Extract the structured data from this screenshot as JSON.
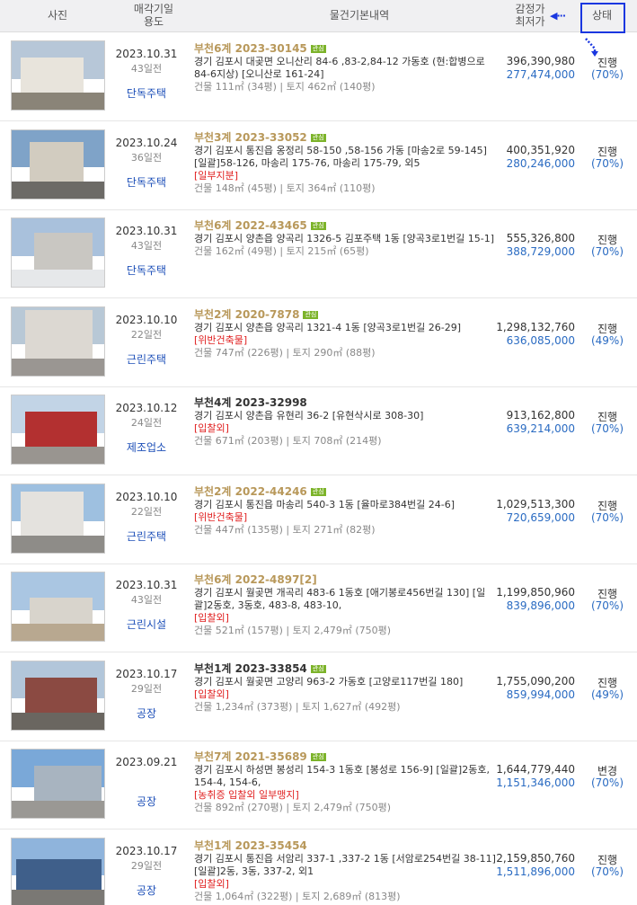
{
  "header": {
    "photo": "사진",
    "date_line1": "매각기일",
    "date_line2": "용도",
    "info": "물건기본내역",
    "price_line1": "감정가",
    "price_line2": "최저가",
    "status": "상태"
  },
  "rows": [
    {
      "date": "2023.10.31",
      "ago": "43일전",
      "use": "단독주택",
      "case": "부천6계 2023-30145",
      "badge": "관심",
      "case_color": "gold",
      "addr": "경기 김포시 대곶면 오니산리 84-6 ,83-2,84-12 가동호 (현:합병으로84-6지상) [오니산로 161-24]",
      "flags": "",
      "area": "건물 111㎡ (34평)  |  토지 462㎡ (140평)",
      "appraisal": "396,390,980",
      "minimum": "277,474,000",
      "status": "진행",
      "pct": "(70%)"
    },
    {
      "date": "2023.10.24",
      "ago": "36일전",
      "use": "단독주택",
      "case": "부천3계 2023-33052",
      "badge": "관심",
      "case_color": "gold",
      "addr": "경기 김포시 통진읍 옹정리 58-150 ,58-156 가동 [마송2로 59-145] [일괄]58-126, 마송리 175-76, 마송리 175-79, 외5",
      "flags": "[일부지분]",
      "area": "건물 148㎡ (45평)  |  토지 364㎡ (110평)",
      "appraisal": "400,351,920",
      "minimum": "280,246,000",
      "status": "진행",
      "pct": "(70%)"
    },
    {
      "date": "2023.10.31",
      "ago": "43일전",
      "use": "단독주택",
      "case": "부천6계 2022-43465",
      "badge": "관심",
      "case_color": "gold",
      "addr": "경기 김포시 양촌읍 양곡리 1326-5 김포주택 1동 [양곡3로1번길 15-1]",
      "flags": "",
      "area": "건물 162㎡ (49평)  |  토지 215㎡ (65평)",
      "appraisal": "555,326,800",
      "minimum": "388,729,000",
      "status": "진행",
      "pct": "(70%)"
    },
    {
      "date": "2023.10.10",
      "ago": "22일전",
      "use": "근린주택",
      "case": "부천2계 2020-7878",
      "badge": "관심",
      "case_color": "gold",
      "addr": "경기 김포시 양촌읍 양곡리 1321-4 1동 [양곡3로1번길 26-29]",
      "flags": "[위반건축물]",
      "area": "건물 747㎡ (226평)  |  토지 290㎡ (88평)",
      "appraisal": "1,298,132,760",
      "minimum": "636,085,000",
      "status": "진행",
      "pct": "(49%)"
    },
    {
      "date": "2023.10.12",
      "ago": "24일전",
      "use": "제조업소",
      "case": "부천4계 2023-32998",
      "badge": "",
      "case_color": "black",
      "addr": "경기 김포시 양촌읍 유현리 36-2 [유현삭시로 308-30]",
      "flags": "[입찰외]",
      "area": "건물 671㎡ (203평)  |  토지 708㎡ (214평)",
      "appraisal": "913,162,800",
      "minimum": "639,214,000",
      "status": "진행",
      "pct": "(70%)"
    },
    {
      "date": "2023.10.10",
      "ago": "22일전",
      "use": "근린주택",
      "case": "부천2계 2022-44246",
      "badge": "관심",
      "case_color": "gold",
      "addr": "경기 김포시 통진읍 마송리 540-3 1동 [율마로384번길 24-6]",
      "flags": "[위반건축물]",
      "area": "건물 447㎡ (135평)  |  토지 271㎡ (82평)",
      "appraisal": "1,029,513,300",
      "minimum": "720,659,000",
      "status": "진행",
      "pct": "(70%)"
    },
    {
      "date": "2023.10.31",
      "ago": "43일전",
      "use": "근린시설",
      "case": "부천6계 2022-4897[2]",
      "badge": "",
      "case_color": "gold",
      "addr": "경기 김포시 월곶면 개곡리 483-6 1동호 [애기봉로456번길 130] [일괄]2동호, 3동호, 483-8, 483-10,",
      "flags": "[입찰외]",
      "area": "건물 521㎡ (157평)  |  토지 2,479㎡ (750평)",
      "appraisal": "1,199,850,960",
      "minimum": "839,896,000",
      "status": "진행",
      "pct": "(70%)"
    },
    {
      "date": "2023.10.17",
      "ago": "29일전",
      "use": "공장",
      "case": "부천1계 2023-33854",
      "badge": "관심",
      "case_color": "black",
      "addr": "경기 김포시 월곶면 고양리 963-2 가동호 [고양로117번길 180]",
      "flags": "[입찰외]",
      "area": "건물 1,234㎡ (373평)  |  토지 1,627㎡ (492평)",
      "appraisal": "1,755,090,200",
      "minimum": "859,994,000",
      "status": "진행",
      "pct": "(49%)"
    },
    {
      "date": "2023.09.21",
      "ago": "",
      "use": "공장",
      "case": "부천7계 2021-35689",
      "badge": "관심",
      "case_color": "gold",
      "addr": "경기 김포시 하성면 봉성리 154-3 1동호 [봉성로 156-9] [일괄]2동호, 154-4, 154-6,",
      "flags": "[농취증  입찰외  일부맹지]",
      "area": "건물 892㎡ (270평)  |  토지 2,479㎡ (750평)",
      "appraisal": "1,644,779,440",
      "minimum": "1,151,346,000",
      "status": "변경",
      "pct": "(70%)"
    },
    {
      "date": "2023.10.17",
      "ago": "29일전",
      "use": "공장",
      "case": "부천1계 2023-35454",
      "badge": "",
      "case_color": "gold",
      "addr": "경기 김포시 통진읍 서암리 337-1 ,337-2 1동 [서암로254번길 38-11] [일괄]2동, 3동, 337-2, 외1",
      "flags": "[입찰외]",
      "area": "건물 1,064㎡ (322평)  |  토지 2,689㎡ (813평)",
      "appraisal": "2,159,850,760",
      "minimum": "1,511,896,000",
      "status": "진행",
      "pct": "(70%)"
    }
  ]
}
